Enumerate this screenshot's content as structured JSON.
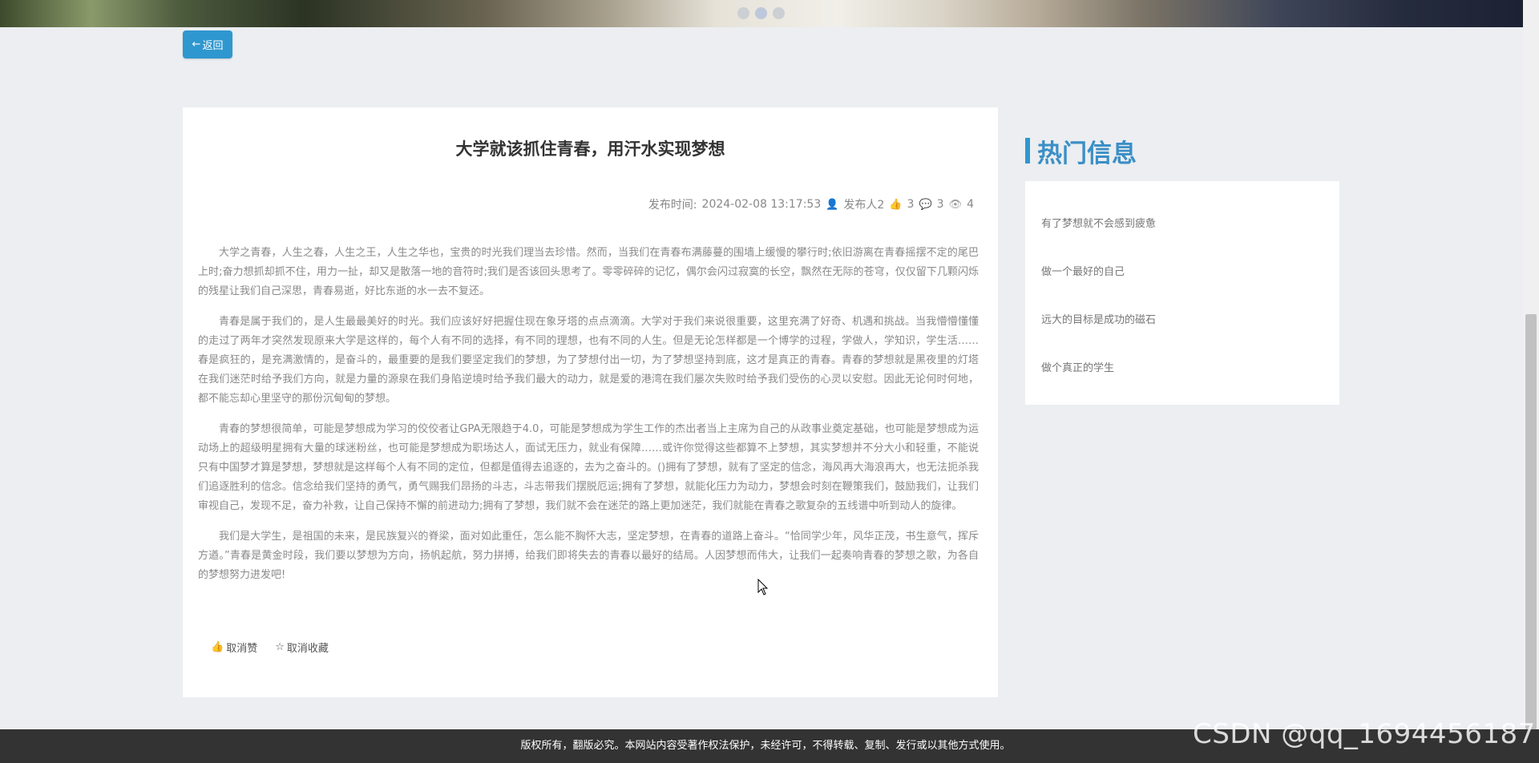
{
  "banner": {
    "slides": 3,
    "active_slide": 2
  },
  "nav": {
    "back_label": "返回",
    "back_icon": "arrow-left-icon"
  },
  "article": {
    "title": "大学就该抓住青春，用汗水实现梦想",
    "meta": {
      "publish_label": "发布时间:",
      "publish_time": "2024-02-08 13:17:53",
      "publisher": "发布人2",
      "likes": "3",
      "comments": "3",
      "views": "4"
    },
    "paragraphs": [
      "大学之青春，人生之春，人生之王，人生之华也，宝贵的时光我们理当去珍惜。然而，当我们在青春布满藤蔓的围墙上缓慢的攀行时;依旧游离在青春摇摆不定的尾巴上时;奋力想抓却抓不住，用力一扯，却又是散落一地的音符时;我们是否该回头思考了。零零碎碎的记忆，偶尔会闪过寂寞的长空，飘然在无际的苍穹，仅仅留下几颗闪烁的残星让我们自己深思，青春易逝，好比东逝的水一去不复还。",
      "青春是属于我们的，是人生最最美好的时光。我们应该好好把握住现在象牙塔的点点滴滴。大学对于我们来说很重要，这里充满了好奇、机遇和挑战。当我懵懵懂懂的走过了两年才突然发现原来大学是这样的，每个人有不同的选择，有不同的理想，也有不同的人生。但是无论怎样都是一个博学的过程，学做人，学知识，学生活……春是疯狂的，是充满激情的，是奋斗的，最重要的是我们要坚定我们的梦想，为了梦想付出一切，为了梦想坚持到底，这才是真正的青春。青春的梦想就是黑夜里的灯塔在我们迷茫时给予我们方向，就是力量的源泉在我们身陷逆境时给予我们最大的动力，就是爱的港湾在我们屡次失败时给予我们受伤的心灵以安慰。因此无论何时何地，都不能忘却心里坚守的那份沉甸甸的梦想。",
      "青春的梦想很简单，可能是梦想成为学习的佼佼者让GPA无限趋于4.0，可能是梦想成为学生工作的杰出者当上主席为自己的从政事业奠定基础，也可能是梦想成为运动场上的超级明星拥有大量的球迷粉丝，也可能是梦想成为职场达人，面试无压力，就业有保障……或许你觉得这些都算不上梦想，其实梦想并不分大小和轻重，不能说只有中国梦才算是梦想，梦想就是这样每个人有不同的定位，但都是值得去追逐的，去为之奋斗的。()拥有了梦想，就有了坚定的信念，海风再大海浪再大，也无法扼杀我们追逐胜利的信念。信念给我们坚持的勇气，勇气赐我们昂扬的斗志，斗志带我们摆脱厄运;拥有了梦想，就能化压力为动力，梦想会时刻在鞭策我们，鼓励我们，让我们审视自己，发现不足，奋力补救，让自己保持不懈的前进动力;拥有了梦想，我们就不会在迷茫的路上更加迷茫，我们就能在青春之歌复杂的五线谱中听到动人的旋律。",
      "我们是大学生，是祖国的未来，是民族复兴的脊梁，面对如此重任，怎么能不胸怀大志，坚定梦想，在青春的道路上奋斗。“恰同学少年，风华正茂，书生意气，挥斥方遒。”青春是黄金时段，我们要以梦想为方向，扬帆起航，努力拼搏，给我们即将失去的青春以最好的结局。人因梦想而伟大，让我们一起奏响青春的梦想之歌，为各自的梦想努力进发吧!"
    ],
    "actions": {
      "unlike_label": "取消赞",
      "unfavorite_label": "取消收藏"
    }
  },
  "hot": {
    "title": "热门信息",
    "items": [
      "有了梦想就不会感到疲惫",
      "做一个最好的自己",
      "远大的目标是成功的磁石",
      "做个真正的学生"
    ]
  },
  "footer": {
    "copyright": "版权所有，翻版必究。本网站内容受著作权法保护，未经许可，不得转载、复制、发行或以其他方式使用。"
  },
  "watermark": "CSDN @qq_1694456187",
  "colors": {
    "accent": "#2f97cf",
    "footer_bg": "#333333",
    "page_bg": "#eceef1"
  }
}
